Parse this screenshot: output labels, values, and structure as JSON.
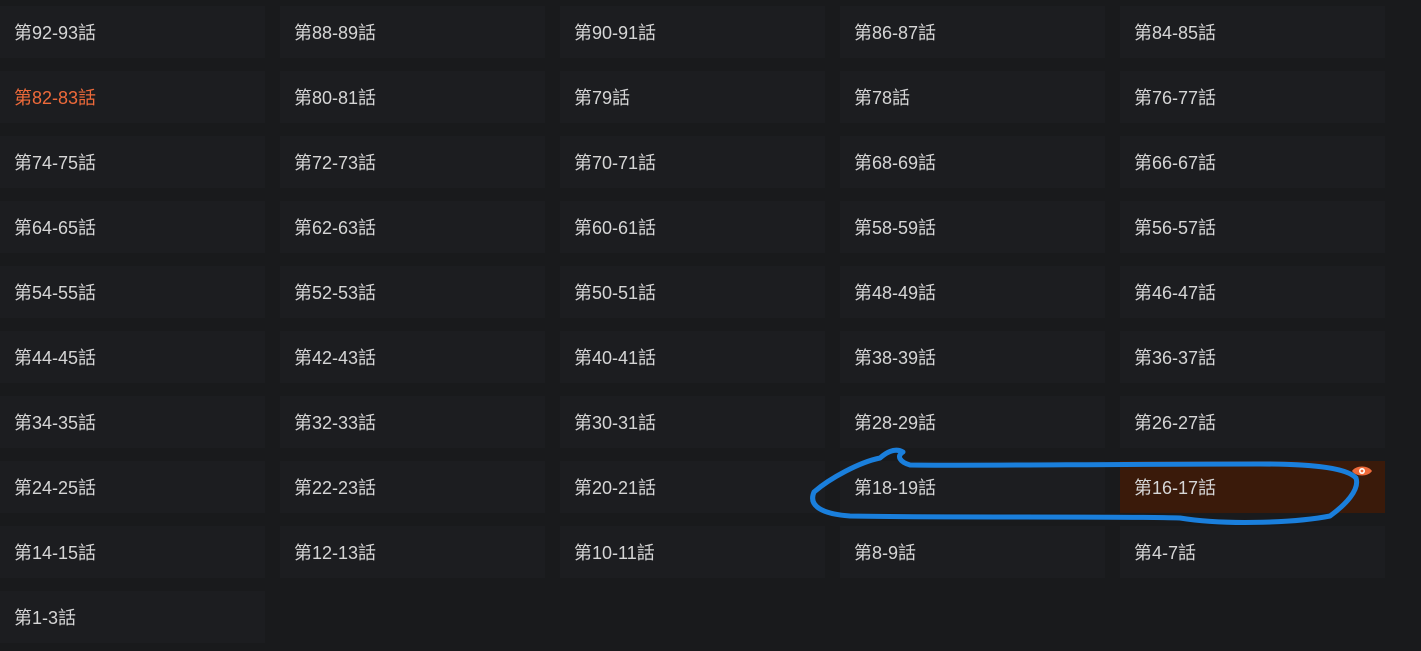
{
  "theme": {
    "background": "#191a1c",
    "cell_background": "#1c1d20",
    "text_color": "#d6d6d6",
    "accent_color": "#ee6a3a",
    "highlight_background": "#3a1a0a",
    "annotation_color": "#1a7fdc"
  },
  "episodes": {
    "items": [
      {
        "label": "第92-93話"
      },
      {
        "label": "第88-89話"
      },
      {
        "label": "第90-91話"
      },
      {
        "label": "第86-87話"
      },
      {
        "label": "第84-85話"
      },
      {
        "label": "第82-83話",
        "current": true
      },
      {
        "label": "第80-81話"
      },
      {
        "label": "第79話"
      },
      {
        "label": "第78話"
      },
      {
        "label": "第76-77話"
      },
      {
        "label": "第74-75話"
      },
      {
        "label": "第72-73話"
      },
      {
        "label": "第70-71話"
      },
      {
        "label": "第68-69話"
      },
      {
        "label": "第66-67話"
      },
      {
        "label": "第64-65話"
      },
      {
        "label": "第62-63話"
      },
      {
        "label": "第60-61話"
      },
      {
        "label": "第58-59話"
      },
      {
        "label": "第56-57話"
      },
      {
        "label": "第54-55話"
      },
      {
        "label": "第52-53話"
      },
      {
        "label": "第50-51話"
      },
      {
        "label": "第48-49話"
      },
      {
        "label": "第46-47話"
      },
      {
        "label": "第44-45話"
      },
      {
        "label": "第42-43話"
      },
      {
        "label": "第40-41話"
      },
      {
        "label": "第38-39話"
      },
      {
        "label": "第36-37話"
      },
      {
        "label": "第34-35話"
      },
      {
        "label": "第32-33話"
      },
      {
        "label": "第30-31話"
      },
      {
        "label": "第28-29話"
      },
      {
        "label": "第26-27話"
      },
      {
        "label": "第24-25話"
      },
      {
        "label": "第22-23話"
      },
      {
        "label": "第20-21話"
      },
      {
        "label": "第18-19話"
      },
      {
        "label": "第16-17話",
        "last_read": true,
        "icon": "eye-icon"
      },
      {
        "label": "第14-15話"
      },
      {
        "label": "第12-13話"
      },
      {
        "label": "第10-11話"
      },
      {
        "label": "第8-9話"
      },
      {
        "label": "第4-7話"
      },
      {
        "label": "第1-3話"
      }
    ]
  }
}
